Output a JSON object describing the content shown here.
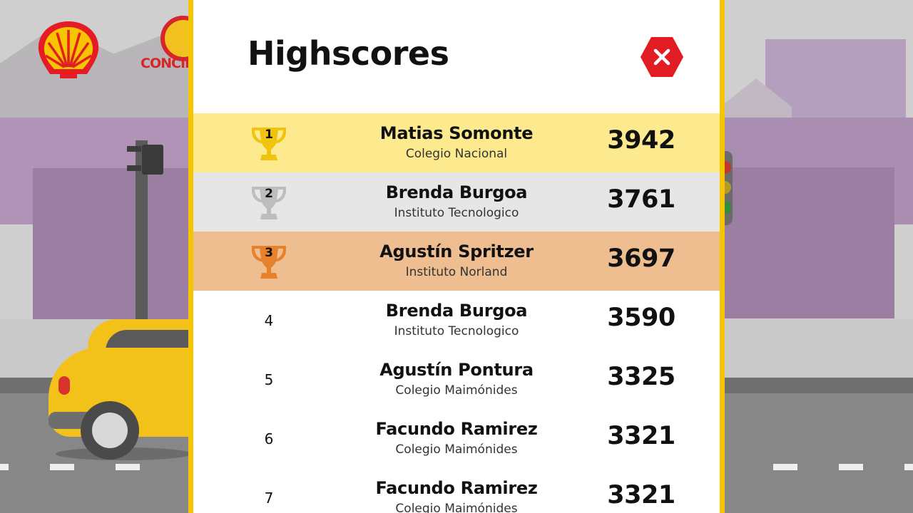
{
  "background": {
    "logos": {
      "shell_icon": "shell-logo-icon",
      "brand_text": "CONCIEN VIA"
    }
  },
  "modal": {
    "title": "Highscores",
    "close_icon": "close-icon",
    "colors": {
      "border": "#f5c500",
      "gold_row": "#fde98e",
      "silver_row": "#e6e6e6",
      "bronze_row": "#eebe91",
      "gold_trophy": "#f0c30f",
      "silver_trophy": "#bdbdbd",
      "bronze_trophy": "#e8822a",
      "close_button": "#e11c23"
    },
    "rows": [
      {
        "rank": "1",
        "name": "Matias Somonte",
        "school": "Colegio Nacional",
        "score": "3942",
        "medal": "gold"
      },
      {
        "rank": "2",
        "name": "Brenda Burgoa",
        "school": "Instituto Tecnologico",
        "score": "3761",
        "medal": "silver"
      },
      {
        "rank": "3",
        "name": "Agustín Spritzer",
        "school": "Instituto Norland",
        "score": "3697",
        "medal": "bronze"
      },
      {
        "rank": "4",
        "name": "Brenda Burgoa",
        "school": "Instituto Tecnologico",
        "score": "3590",
        "medal": "none"
      },
      {
        "rank": "5",
        "name": "Agustín Pontura",
        "school": "Colegio Maimónides",
        "score": "3325",
        "medal": "none"
      },
      {
        "rank": "6",
        "name": "Facundo Ramirez",
        "school": "Colegio Maimónides",
        "score": "3321",
        "medal": "none"
      },
      {
        "rank": "7",
        "name": "Facundo Ramirez",
        "school": "Colegio Maimónides",
        "score": "3321",
        "medal": "none"
      }
    ]
  }
}
